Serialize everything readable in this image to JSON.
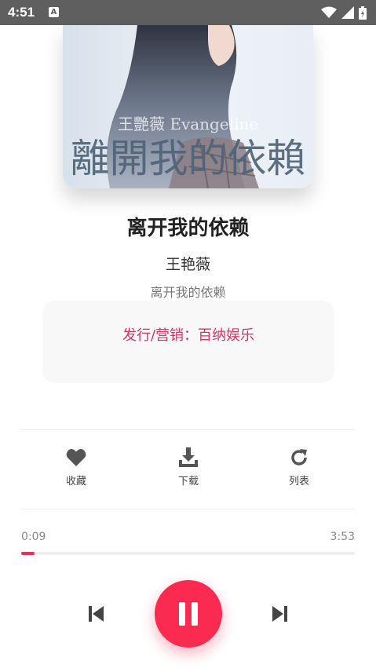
{
  "status_bar": {
    "time": "4:51",
    "notification_letter": "A",
    "icons": [
      "wifi-icon",
      "signal-icon",
      "battery-icon"
    ]
  },
  "cover": {
    "artist_text": "王艷薇 Evangeline",
    "title_text": "離開我的依賴"
  },
  "song": {
    "title": "离开我的依赖",
    "artist": "王艳薇",
    "album": "离开我的依赖"
  },
  "info": {
    "publisher": "发行/营销：百纳娱乐"
  },
  "actions": [
    {
      "label": "收藏",
      "icon": "heart-icon"
    },
    {
      "label": "下载",
      "icon": "download-icon"
    },
    {
      "label": "列表",
      "icon": "refresh-icon"
    }
  ],
  "playback": {
    "current_time": "0:09",
    "total_time": "3:53",
    "progress": 0.039
  },
  "colors": {
    "accent": "#fa2a51",
    "status_bar": "#5f5f5f",
    "info_text": "#e0325c"
  }
}
